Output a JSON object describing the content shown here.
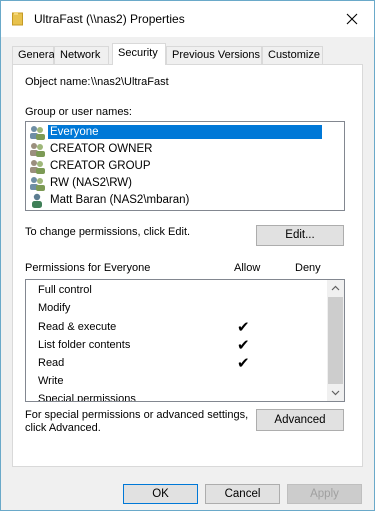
{
  "window": {
    "title": "UltraFast (\\\\nas2) Properties",
    "icon": "folder-icon"
  },
  "tabs": [
    {
      "label": "General"
    },
    {
      "label": "Network"
    },
    {
      "label": "Security",
      "active": true
    },
    {
      "label": "Previous Versions"
    },
    {
      "label": "Customize"
    }
  ],
  "security": {
    "object_name_label": "Object name:",
    "object_name_value": "\\\\nas2\\UltraFast",
    "group_label": "Group or user names:",
    "users": [
      {
        "name": "Everyone",
        "icon": "group-icon",
        "selected": true
      },
      {
        "name": "CREATOR OWNER",
        "icon": "group-icon"
      },
      {
        "name": "CREATOR GROUP",
        "icon": "group-icon"
      },
      {
        "name": "RW (NAS2\\RW)",
        "icon": "group-icon"
      },
      {
        "name": "Matt Baran (NAS2\\mbaran)",
        "icon": "user-icon"
      }
    ],
    "change_hint": "To change permissions, click Edit.",
    "edit_label": "Edit...",
    "perm_header": "Permissions for Everyone",
    "allow_header": "Allow",
    "deny_header": "Deny",
    "permissions": [
      {
        "name": "Full control",
        "allow": false,
        "deny": false
      },
      {
        "name": "Modify",
        "allow": false,
        "deny": false
      },
      {
        "name": "Read & execute",
        "allow": true,
        "deny": false
      },
      {
        "name": "List folder contents",
        "allow": true,
        "deny": false
      },
      {
        "name": "Read",
        "allow": true,
        "deny": false
      },
      {
        "name": "Write",
        "allow": false,
        "deny": false
      },
      {
        "name": "Special permissions",
        "allow": false,
        "deny": false
      }
    ],
    "advanced_hint_line1": "For special permissions or advanced settings,",
    "advanced_hint_line2": "click Advanced.",
    "advanced_label": "Advanced"
  },
  "footer": {
    "ok_label": "OK",
    "cancel_label": "Cancel",
    "apply_label": "Apply"
  },
  "colors": {
    "selection": "#0078d7",
    "accent_border": "#0078d7"
  }
}
